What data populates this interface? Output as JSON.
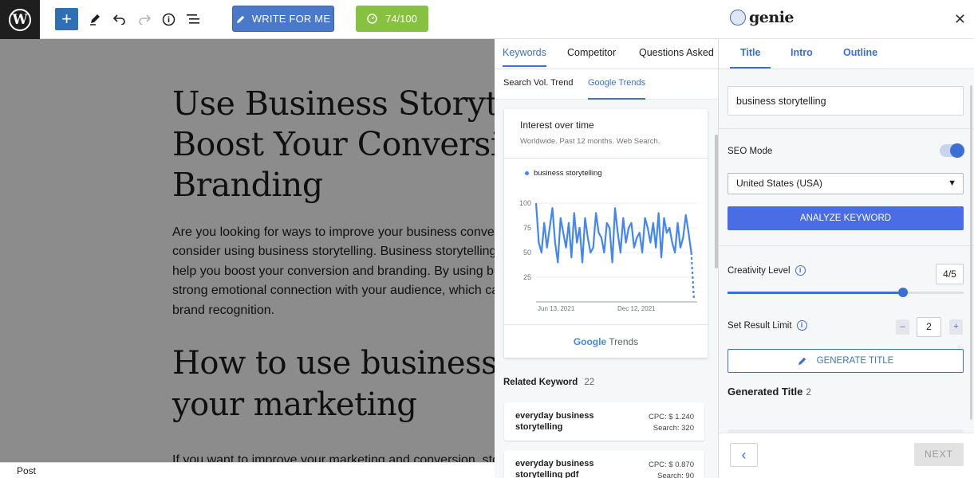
{
  "toolbar": {
    "write_label": "WRITE FOR ME",
    "score_label": "74/100",
    "icons": [
      "wordpress-icon",
      "plus-icon",
      "pencil-icon",
      "undo-icon",
      "redo-icon",
      "info-icon",
      "list-view-icon"
    ]
  },
  "editor": {
    "title": "Use Business Storytelling to Boost Your Conversion and Branding",
    "paragraph": "Are you looking for ways to improve your business conversion rates? If so, you may want to consider using business storytelling. Business storytelling is a powerful marketing tool that can help you boost your conversion and branding. By using business storytelling, you can create a strong emotional connection with your audience, which can lead to improved conversions and brand recognition.",
    "heading2": "How to use business storytelling in your marketing",
    "paragraph2": "If you want to improve your marketing and conversion, storytelling",
    "status": "Post"
  },
  "middle": {
    "tabs": [
      "Keywords",
      "Competitor",
      "Questions Asked"
    ],
    "sub_tabs": [
      "Search Vol. Trend",
      "Google Trends"
    ],
    "trends": {
      "title": "Interest over time",
      "subtitle": "Worldwide. Past 12 months. Web Search.",
      "legend": "business storytelling",
      "y_ticks": [
        "100",
        "75",
        "50",
        "25"
      ],
      "x_ticks": [
        "Jun 13, 2021",
        "Dec 12, 2021"
      ],
      "footer_brand": "Google",
      "footer_product": " Trends"
    },
    "related": {
      "heading": "Related Keyword",
      "count": "22",
      "items": [
        {
          "name": "everyday business storytelling",
          "cpc": "CPC: $ 1.240",
          "search": "Search: 320"
        },
        {
          "name": "everyday business storytelling pdf",
          "cpc": "CPC: $ 0.870",
          "search": "Search: 90"
        }
      ]
    }
  },
  "right": {
    "brand": "genie",
    "tabs": [
      "Title",
      "Intro",
      "Outline"
    ],
    "keyword_value": "business storytelling",
    "seo_mode_label": "SEO Mode",
    "seo_mode_on": true,
    "country": "United States (USA)",
    "analyze_label": "ANALYZE KEYWORD",
    "creativity_label": "Creativity Level",
    "creativity_value": "4/5",
    "creativity_level": 0.8,
    "limit_label": "Set Result Limit",
    "limit_value": "2",
    "generate_label": "GENERATE TITLE",
    "generated_label": "Generated Title",
    "generated_count": "2",
    "next_label": "NEXT"
  },
  "colors": {
    "accent": "#3a6fd6",
    "write_button": "#4a79c9",
    "score_button": "#86c13f",
    "trend_line": "#4285f4"
  },
  "chart_data": {
    "type": "line",
    "title": "Interest over time",
    "subtitle": "Worldwide. Past 12 months. Web Search.",
    "series": [
      {
        "name": "business storytelling",
        "values": [
          100,
          60,
          50,
          80,
          55,
          75,
          95,
          60,
          40,
          85,
          70,
          55,
          80,
          45,
          90,
          60,
          75,
          40,
          85,
          65,
          50,
          55,
          90,
          70,
          65,
          50,
          80,
          75,
          40,
          95,
          70,
          50,
          85,
          60,
          75,
          80,
          55,
          65,
          70,
          50,
          85,
          75,
          60,
          80,
          55,
          90,
          45,
          85,
          70,
          75,
          60,
          50,
          80,
          55,
          65,
          88,
          70,
          50,
          2
        ]
      }
    ],
    "x_ticks": [
      "Jun 13, 2021",
      "Dec 12, 2021"
    ],
    "ylim": [
      0,
      100
    ],
    "y_ticks": [
      25,
      50,
      75,
      100
    ],
    "grid": true,
    "legend": "top-left"
  }
}
